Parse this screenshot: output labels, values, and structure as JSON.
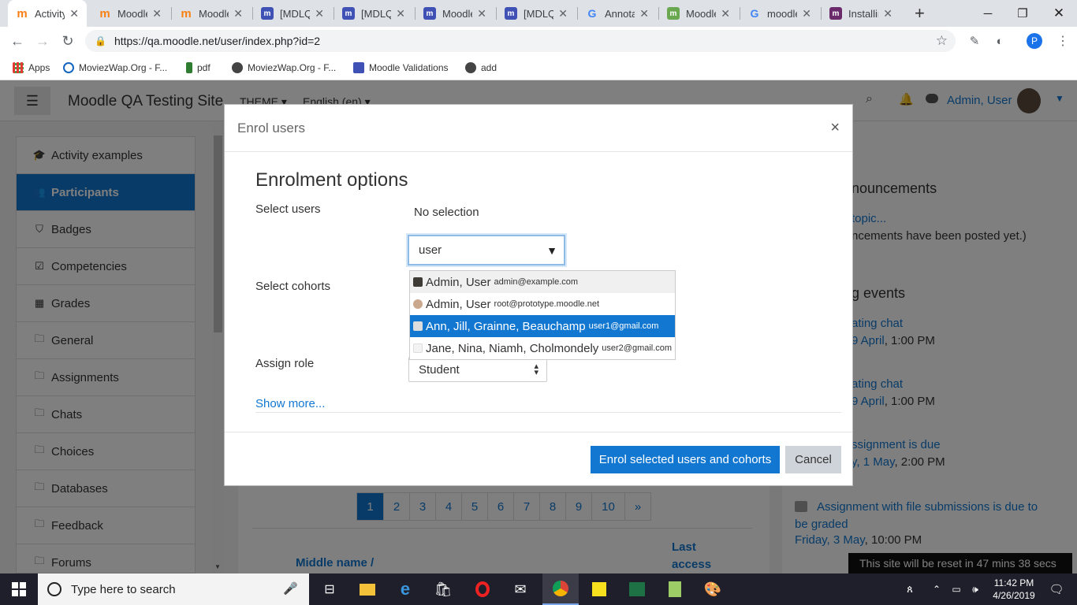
{
  "browser": {
    "tabs": [
      {
        "title": "Activity",
        "color": "#f98012",
        "glyph": "m"
      },
      {
        "title": "Moodle",
        "color": "#f98012",
        "glyph": "m"
      },
      {
        "title": "Moodle",
        "color": "#f98012",
        "glyph": "m"
      },
      {
        "title": "[MDLQ",
        "color": "#3f51b5",
        "glyph": "m"
      },
      {
        "title": "[MDLQ",
        "color": "#3f51b5",
        "glyph": "m"
      },
      {
        "title": "Moodle",
        "color": "#3f51b5",
        "glyph": "m"
      },
      {
        "title": "[MDLQ",
        "color": "#3f51b5",
        "glyph": "m"
      },
      {
        "title": "Annota",
        "color": "#4285f4",
        "glyph": "G"
      },
      {
        "title": "Moodle",
        "color": "#6aa84f",
        "glyph": "m"
      },
      {
        "title": "moodle",
        "color": "#4285f4",
        "glyph": "G"
      },
      {
        "title": "Installin",
        "color": "#6b2a6b",
        "glyph": "m"
      }
    ],
    "url": "https://qa.moodle.net/user/index.php?id=2",
    "profile_initial": "P",
    "bookmarks": [
      {
        "label": "Apps"
      },
      {
        "label": "MoviezWap.Org - F..."
      },
      {
        "label": "pdf"
      },
      {
        "label": "MoviezWap.Org - F..."
      },
      {
        "label": "Moodle Validations"
      },
      {
        "label": "add"
      }
    ]
  },
  "moodle": {
    "site_name": "Moodle QA Testing Site",
    "theme_label": "THEME",
    "language_label": "English (en)",
    "user_name": "Admin, User",
    "sidebar": [
      {
        "label": "Activity examples",
        "icon": "graduation-cap-icon",
        "active": false
      },
      {
        "label": "Participants",
        "icon": "users-icon",
        "active": true
      },
      {
        "label": "Badges",
        "icon": "shield-icon",
        "active": false
      },
      {
        "label": "Competencies",
        "icon": "checkbox-icon",
        "active": false
      },
      {
        "label": "Grades",
        "icon": "table-icon",
        "active": false
      },
      {
        "label": "General",
        "icon": "folder-icon",
        "active": false
      },
      {
        "label": "Assignments",
        "icon": "folder-icon",
        "active": false
      },
      {
        "label": "Chats",
        "icon": "folder-icon",
        "active": false
      },
      {
        "label": "Choices",
        "icon": "folder-icon",
        "active": false
      },
      {
        "label": "Databases",
        "icon": "folder-icon",
        "active": false
      },
      {
        "label": "Feedback",
        "icon": "folder-icon",
        "active": false
      },
      {
        "label": "Forums",
        "icon": "folder-icon",
        "active": false
      }
    ],
    "pagination": [
      "1",
      "2",
      "3",
      "4",
      "5",
      "6",
      "7",
      "8",
      "9",
      "10",
      "»"
    ],
    "table_headers": {
      "middle_name": "Middle name /",
      "last_access_1": "Last",
      "last_access_2": "access"
    },
    "right": {
      "announcements_title": "nouncements",
      "announcements_link": "topic...",
      "announcements_text": "ncements have been posted yet.)",
      "events_title": "g events",
      "event1_title": "ating chat",
      "event1_date": "9 April",
      "event1_time": ", 1:00 PM",
      "event2_title": "ating chat",
      "event2_date": "9 April",
      "event2_time": ", 1:00 PM",
      "event3_title": "ssignment is due",
      "event3_date": "y, 1 May",
      "event3_time": ", 2:00 PM",
      "event4_title_1": "Assignment with file submissions is due to",
      "event4_title_2": "be graded",
      "event4_date": "Friday, 3 May",
      "event4_time": ", 10:00 PM"
    },
    "reset_note": "This site will be reset in 47 mins 38 secs"
  },
  "modal": {
    "title": "Enrol users",
    "close": "×",
    "heading": "Enrolment options",
    "select_users_label": "Select users",
    "no_selection": "No selection",
    "search_value": "user",
    "dropdown_items": [
      {
        "name": "Admin, User",
        "email": "admin@example.com",
        "state": "hover"
      },
      {
        "name": "Admin, User",
        "email": "root@prototype.moodle.net",
        "state": "normal"
      },
      {
        "name": "Ann, Jill, Grainne, Beauchamp",
        "email": "user1@gmail.com",
        "state": "selected"
      },
      {
        "name": "Jane, Nina, Niamh, Cholmondely",
        "email": "user2@gmail.com",
        "state": "normal"
      }
    ],
    "select_cohorts_label": "Select cohorts",
    "assign_role_label": "Assign role",
    "role_value": "Student",
    "show_more": "Show more...",
    "enrol_button": "Enrol selected users and cohorts",
    "cancel_button": "Cancel"
  },
  "taskbar": {
    "search_placeholder": "Type here to search",
    "time": "11:42 PM",
    "date": "4/26/2019"
  }
}
